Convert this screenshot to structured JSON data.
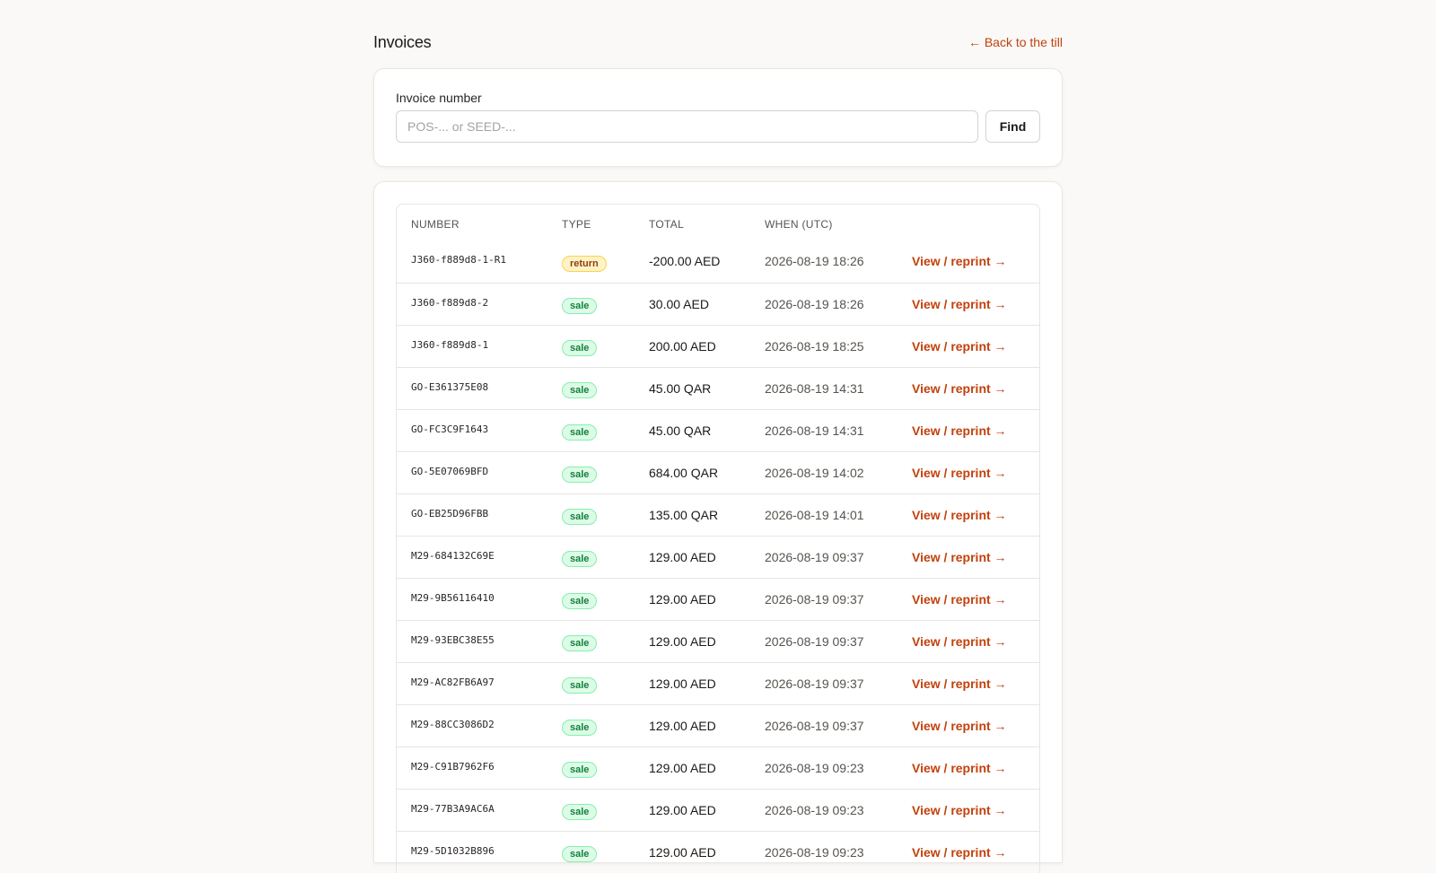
{
  "header": {
    "title": "Invoices",
    "back_link": "← Back to the till"
  },
  "search": {
    "label": "Invoice number",
    "placeholder": "POS-... or SEED-...",
    "value": "",
    "find_label": "Find"
  },
  "table": {
    "columns": [
      "NUMBER",
      "TYPE",
      "TOTAL",
      "WHEN (UTC)",
      ""
    ],
    "link_label": "View / reprint →",
    "rows": [
      {
        "number": "J360-f889d8-1-R1",
        "type": "return",
        "total": "-200.00 AED",
        "when": "2026-08-19 18:26"
      },
      {
        "number": "J360-f889d8-2",
        "type": "sale",
        "total": "30.00 AED",
        "when": "2026-08-19 18:26"
      },
      {
        "number": "J360-f889d8-1",
        "type": "sale",
        "total": "200.00 AED",
        "when": "2026-08-19 18:25"
      },
      {
        "number": "GO-E361375E08",
        "type": "sale",
        "total": "45.00 QAR",
        "when": "2026-08-19 14:31"
      },
      {
        "number": "GO-FC3C9F1643",
        "type": "sale",
        "total": "45.00 QAR",
        "when": "2026-08-19 14:31"
      },
      {
        "number": "GO-5E07069BFD",
        "type": "sale",
        "total": "684.00 QAR",
        "when": "2026-08-19 14:02"
      },
      {
        "number": "GO-EB25D96FBB",
        "type": "sale",
        "total": "135.00 QAR",
        "when": "2026-08-19 14:01"
      },
      {
        "number": "M29-684132C69E",
        "type": "sale",
        "total": "129.00 AED",
        "when": "2026-08-19 09:37"
      },
      {
        "number": "M29-9B56116410",
        "type": "sale",
        "total": "129.00 AED",
        "when": "2026-08-19 09:37"
      },
      {
        "number": "M29-93EBC38E55",
        "type": "sale",
        "total": "129.00 AED",
        "when": "2026-08-19 09:37"
      },
      {
        "number": "M29-AC82FB6A97",
        "type": "sale",
        "total": "129.00 AED",
        "when": "2026-08-19 09:37"
      },
      {
        "number": "M29-88CC3086D2",
        "type": "sale",
        "total": "129.00 AED",
        "when": "2026-08-19 09:37"
      },
      {
        "number": "M29-C91B7962F6",
        "type": "sale",
        "total": "129.00 AED",
        "when": "2026-08-19 09:23"
      },
      {
        "number": "M29-77B3A9AC6A",
        "type": "sale",
        "total": "129.00 AED",
        "when": "2026-08-19 09:23"
      },
      {
        "number": "M29-5D1032B896",
        "type": "sale",
        "total": "129.00 AED",
        "when": "2026-08-19 09:23"
      }
    ]
  },
  "colors": {
    "accent": "#c2410c",
    "background": "#faf9f7",
    "sale_badge_bg": "#dcfce7",
    "sale_badge_text": "#15803d",
    "return_badge_bg": "#fef3c7",
    "return_badge_text": "#92400e"
  }
}
